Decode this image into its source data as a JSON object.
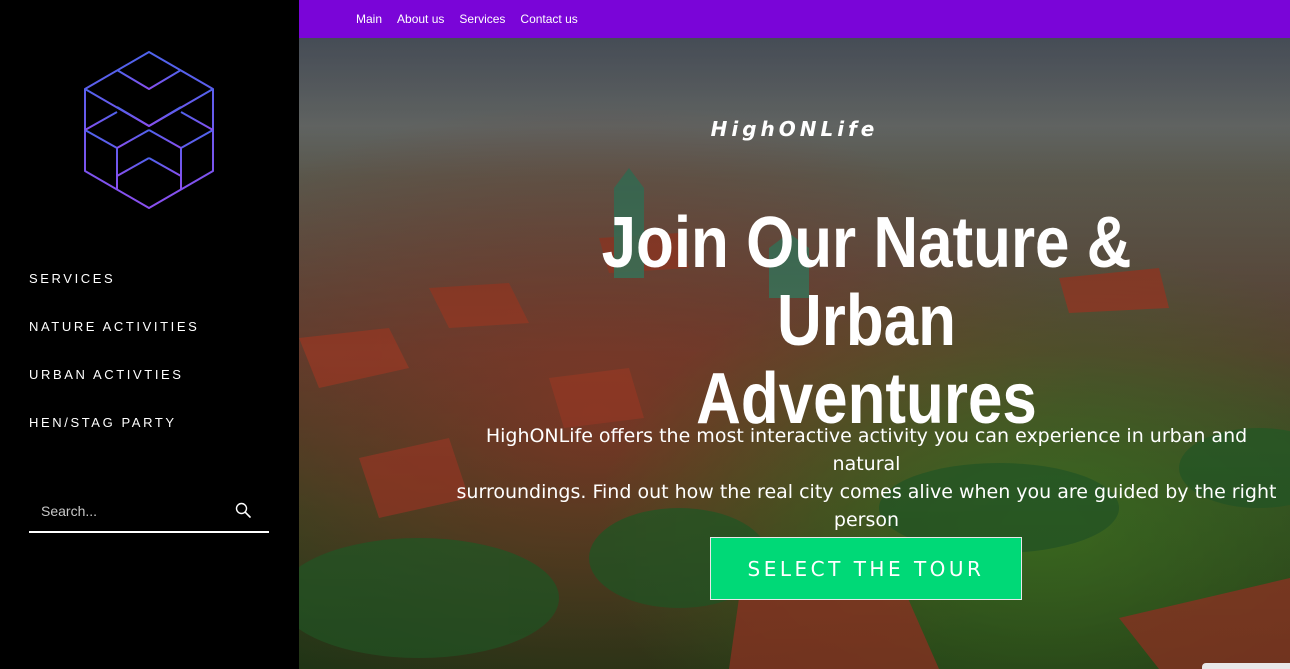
{
  "sidebar": {
    "logo_icon": "hexagon-cubes-logo",
    "nav": [
      {
        "label": "SERVICES"
      },
      {
        "label": "NATURE ACTIVITIES"
      },
      {
        "label": "URBAN ACTIVTIES"
      },
      {
        "label": "HEN/STAG PARTY"
      }
    ],
    "search": {
      "placeholder": "Search...",
      "icon": "search-icon"
    }
  },
  "topbar": {
    "nav": [
      {
        "label": "Main"
      },
      {
        "label": "About us"
      },
      {
        "label": "Services"
      },
      {
        "label": "Contact us"
      }
    ]
  },
  "hero": {
    "brand": "HighONLife",
    "headline_line1": "Join Our Nature & Urban",
    "headline_line2": "Adventures",
    "subtext_line1": "HighONLife offers the most interactive activity you can experience in urban and natural",
    "subtext_line2": "surroundings. Find out how the real city comes alive when you are guided by the right person",
    "cta_label": "SELECT THE TOUR",
    "background": "aerial-city-photo"
  },
  "colors": {
    "topbar": "#7a05d8",
    "cta": "#00d977",
    "logo_stroke": "#5b5cf0",
    "sidebar": "#000000"
  }
}
